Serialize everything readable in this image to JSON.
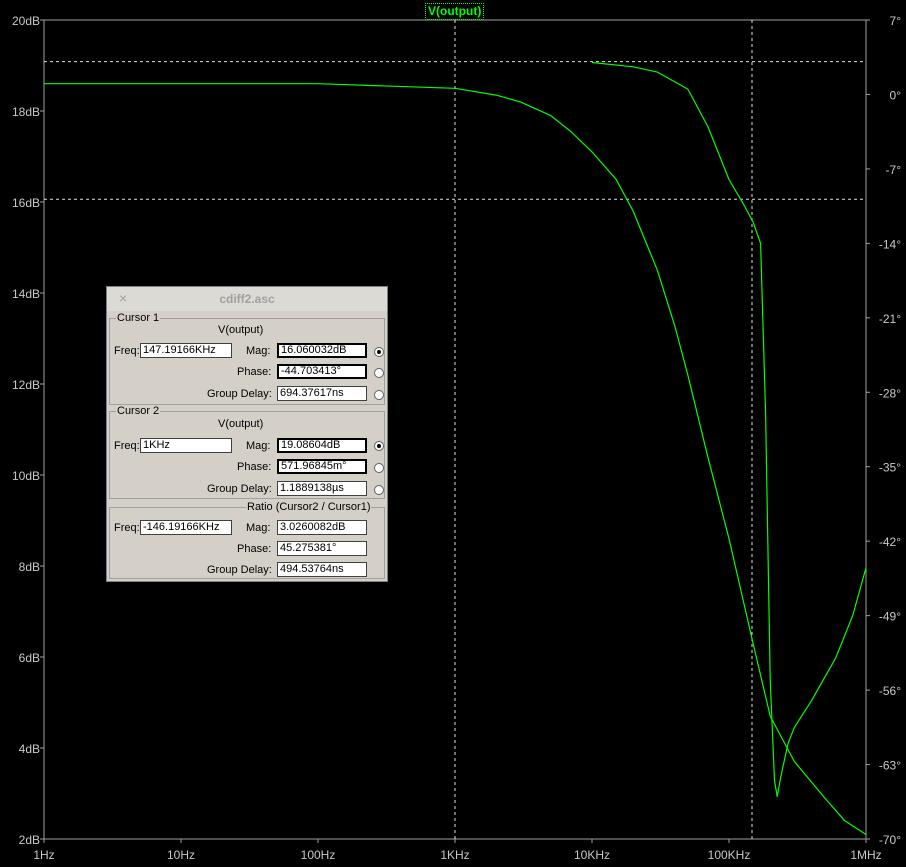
{
  "chart_data": {
    "type": "line",
    "title": "V(output)",
    "x_scale": "log",
    "xlim": [
      1,
      1000000
    ],
    "x_ticks": [
      "1Hz",
      "10Hz",
      "100Hz",
      "1KHz",
      "10KHz",
      "100KHz",
      "1MHz"
    ],
    "left_axis": {
      "range_dB": [
        2,
        20
      ],
      "ticks": [
        "20dB",
        "18dB",
        "16dB",
        "14dB",
        "12dB",
        "10dB",
        "8dB",
        "6dB",
        "4dB",
        "2dB"
      ]
    },
    "right_axis": {
      "range_deg": [
        -70,
        7
      ],
      "ticks": [
        "7°",
        "0°",
        "-7°",
        "-14°",
        "-21°",
        "-28°",
        "-35°",
        "-42°",
        "-49°",
        "-56°",
        "-63°",
        "-70°"
      ]
    },
    "series": [
      {
        "axis": "left",
        "unit": "dB",
        "color": "#00ff00",
        "points": [
          [
            1,
            18.6
          ],
          [
            100,
            18.6
          ],
          [
            1000,
            18.5
          ],
          [
            2000,
            18.35
          ],
          [
            3000,
            18.2
          ],
          [
            5000,
            17.9
          ],
          [
            7000,
            17.55
          ],
          [
            10000,
            17.1
          ],
          [
            15000,
            16.5
          ],
          [
            20000,
            15.8
          ],
          [
            30000,
            14.5
          ],
          [
            40000,
            13.3
          ],
          [
            50000,
            12.2
          ],
          [
            70000,
            10.4
          ],
          [
            100000,
            8.6
          ],
          [
            150000,
            6.3
          ],
          [
            200000,
            4.7
          ],
          [
            300000,
            3.7
          ],
          [
            500000,
            2.9
          ],
          [
            700000,
            2.4
          ],
          [
            1000000,
            2.1
          ]
        ]
      },
      {
        "axis": "right",
        "unit": "deg",
        "color": "#00ff00",
        "points": [
          [
            10000,
            3.0
          ],
          [
            20000,
            2.6
          ],
          [
            30000,
            2.1
          ],
          [
            50000,
            0.5
          ],
          [
            70000,
            -3.0
          ],
          [
            100000,
            -8.0
          ],
          [
            130000,
            -10.5
          ],
          [
            150000,
            -12.0
          ],
          [
            170000,
            -14.0
          ],
          [
            185000,
            -30.0
          ],
          [
            200000,
            -55.0
          ],
          [
            215000,
            -64.5
          ],
          [
            225000,
            -66.0
          ],
          [
            240000,
            -64.0
          ],
          [
            270000,
            -61.0
          ],
          [
            300000,
            -59.5
          ],
          [
            400000,
            -57.0
          ],
          [
            600000,
            -53.0
          ],
          [
            800000,
            -49.0
          ],
          [
            1000000,
            -44.5
          ]
        ]
      }
    ],
    "cursors": [
      {
        "freq_hz": 1000,
        "mag_db": 19.086
      },
      {
        "freq_hz": 147191.66,
        "mag_db": 16.06
      }
    ],
    "background": "#000000",
    "grid": false
  },
  "dialog": {
    "title": "cdiff2.asc",
    "close": "×",
    "cursor1": {
      "group": "Cursor 1",
      "trace": "V(output)",
      "freq_label": "Freq:",
      "freq": "147.19166KHz",
      "mag_label": "Mag:",
      "mag": "16.060032dB",
      "phase_label": "Phase:",
      "phase": "-44.703413°",
      "gd_label": "Group Delay:",
      "gd": "694.37617ns"
    },
    "cursor2": {
      "group": "Cursor 2",
      "trace": "V(output)",
      "freq_label": "Freq:",
      "freq": "1KHz",
      "mag_label": "Mag:",
      "mag": "19.08604dB",
      "phase_label": "Phase:",
      "phase": "571.96845m°",
      "gd_label": "Group Delay:",
      "gd": "1.1889138µs"
    },
    "ratio": {
      "group": "Ratio (Cursor2 / Cursor1)",
      "freq_label": "Freq:",
      "freq": "-146.19166KHz",
      "mag_label": "Mag:",
      "mag": "3.0260082dB",
      "phase_label": "Phase:",
      "phase": "45.275381°",
      "gd_label": "Group Delay:",
      "gd": "494.53764ns"
    }
  }
}
